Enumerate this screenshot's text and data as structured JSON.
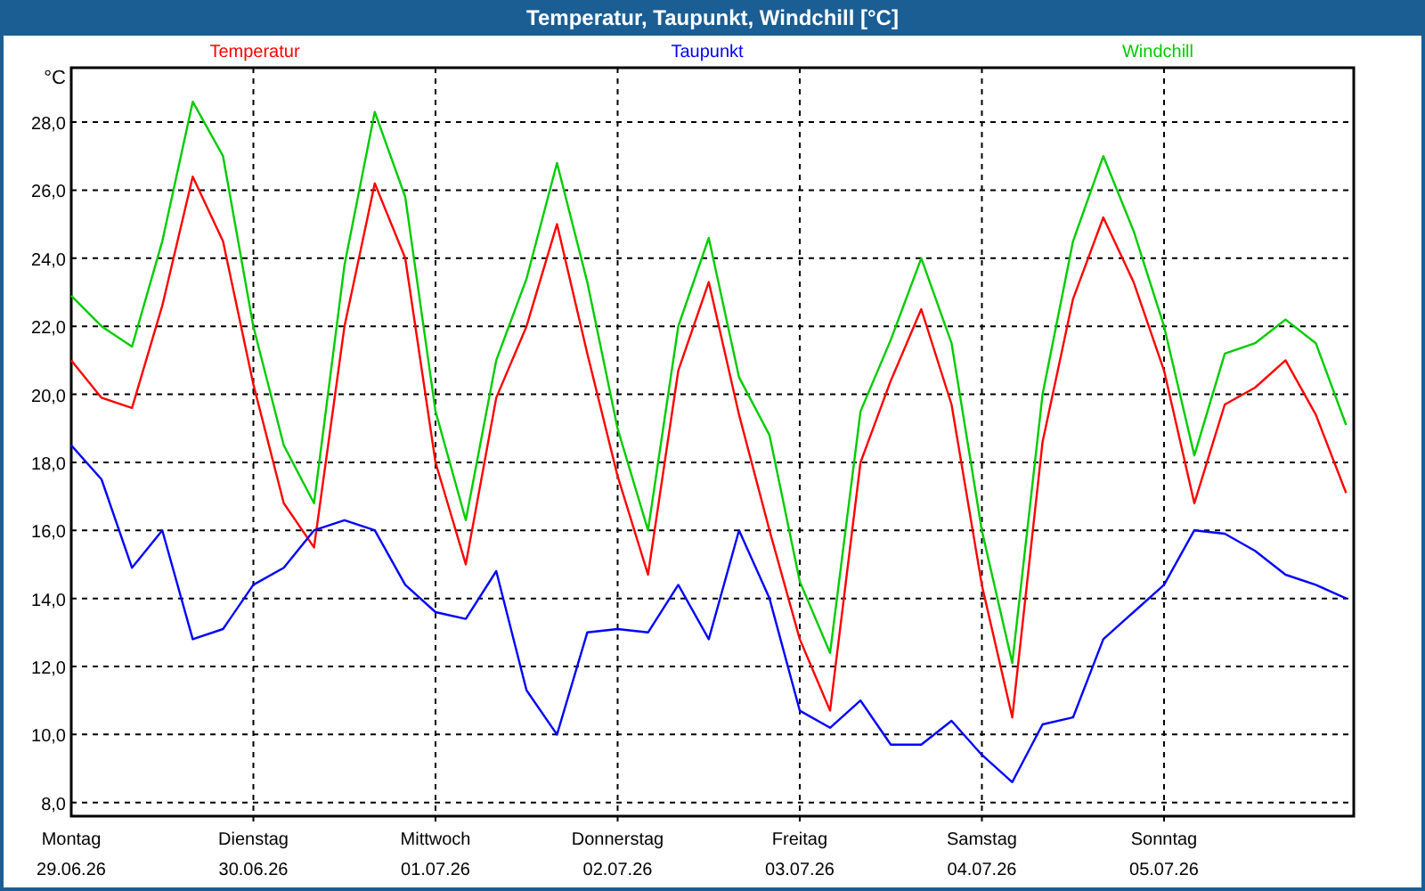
{
  "window": {
    "title": "Temperatur, Taupunkt, Windchill [°C]"
  },
  "chart": {
    "dates": [
      "29.06.26",
      "30.06.26",
      "01.07.26",
      "02.07.26",
      "03.07.26",
      "04.07.26",
      "05.07.26"
    ],
    "chart_data": {
      "type": "line",
      "ylabel": "°C",
      "ylim": [
        7.6,
        29.6
      ],
      "grid": true,
      "categories": [
        "Montag",
        null,
        null,
        null,
        null,
        null,
        "Dienstag",
        null,
        null,
        null,
        null,
        null,
        "Mittwoch",
        null,
        null,
        null,
        null,
        null,
        "Donnerstag",
        null,
        null,
        null,
        null,
        null,
        "Freitag",
        null,
        null,
        null,
        null,
        null,
        "Samstag",
        null,
        null,
        null,
        null,
        null,
        "Sonntag",
        null,
        null,
        null,
        null,
        null,
        null
      ],
      "series": [
        {
          "name": "Temperatur",
          "color": "#ff0000",
          "values": [
            21.0,
            19.9,
            19.6,
            22.6,
            26.4,
            24.5,
            20.3,
            16.8,
            15.5,
            22.0,
            26.2,
            24.0,
            18.0,
            15.0,
            19.9,
            22.0,
            25.0,
            21.2,
            17.6,
            14.7,
            20.7,
            23.3,
            19.4,
            16.0,
            12.8,
            10.7,
            18.0,
            20.4,
            22.5,
            19.7,
            14.4,
            10.5,
            18.6,
            22.8,
            25.2,
            23.3,
            20.7,
            16.8,
            19.7,
            20.2,
            21.0,
            19.4,
            17.1
          ]
        },
        {
          "name": "Taupunkt",
          "color": "#0000ff",
          "values": [
            18.5,
            17.5,
            14.9,
            16.0,
            12.8,
            13.1,
            14.4,
            14.9,
            16.0,
            16.3,
            16.0,
            14.4,
            13.6,
            13.4,
            14.8,
            11.3,
            10.0,
            13.0,
            13.1,
            13.0,
            14.4,
            12.8,
            16.0,
            14.0,
            10.7,
            10.2,
            11.0,
            9.7,
            9.7,
            10.4,
            9.4,
            8.6,
            10.3,
            10.5,
            12.8,
            13.6,
            14.4,
            16.0,
            15.9,
            15.4,
            14.7,
            14.4,
            14.0
          ]
        },
        {
          "name": "Windchill",
          "color": "#00cc00",
          "values": [
            22.9,
            22.0,
            21.4,
            24.5,
            28.6,
            27.0,
            22.0,
            18.5,
            16.8,
            23.8,
            28.3,
            25.8,
            19.5,
            16.3,
            21.0,
            23.4,
            26.8,
            23.3,
            19.0,
            16.0,
            22.0,
            24.6,
            20.5,
            18.8,
            14.5,
            12.4,
            19.5,
            21.6,
            24.0,
            21.5,
            16.0,
            12.1,
            20.0,
            24.5,
            27.0,
            24.8,
            22.0,
            18.2,
            21.2,
            21.5,
            22.2,
            21.5,
            19.1
          ]
        }
      ],
      "yticks": [
        {
          "value": 8,
          "label": "8,0"
        },
        {
          "value": 10,
          "label": "10,0"
        },
        {
          "value": 12,
          "label": "12,0"
        },
        {
          "value": 14,
          "label": "14,0"
        },
        {
          "value": 16,
          "label": "16,0"
        },
        {
          "value": 18,
          "label": "18,0"
        },
        {
          "value": 20,
          "label": "20,0"
        },
        {
          "value": 22,
          "label": "22,0"
        },
        {
          "value": 24,
          "label": "24,0"
        },
        {
          "value": 26,
          "label": "26,0"
        },
        {
          "value": 28,
          "label": "28,0"
        }
      ]
    }
  }
}
